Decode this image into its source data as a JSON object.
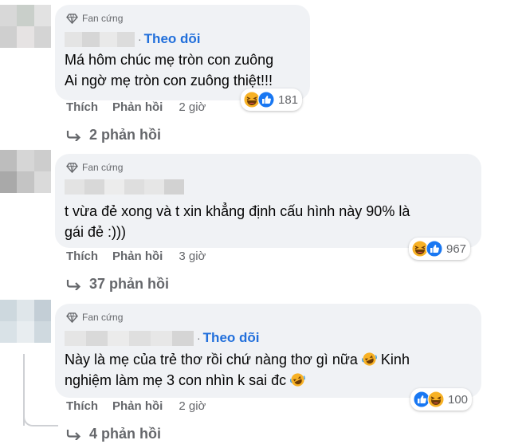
{
  "comments": [
    {
      "badge": "Fan cứng",
      "follow": "Theo dõi",
      "dot": "·",
      "text_lines": [
        "Má hôm chúc mẹ tròn con zuông",
        "Ai ngờ mẹ tròn con zuông thiệt!!!"
      ],
      "reactions": [
        "haha-icon",
        "like-icon"
      ],
      "reaction_count": "181",
      "like": "Thích",
      "reply": "Phản hồi",
      "time": "2 giờ",
      "replies": "2 phản hồi"
    },
    {
      "badge": "Fan cứng",
      "text_lines": [
        "t vừa đẻ xong và t xin khẳng định cấu hình này 90% là",
        "gái đẻ :)))"
      ],
      "reactions": [
        "haha-icon",
        "like-icon"
      ],
      "reaction_count": "967",
      "like": "Thích",
      "reply": "Phản hồi",
      "time": "3 giờ",
      "replies": "37 phản hồi"
    },
    {
      "badge": "Fan cứng",
      "follow": "Theo dõi",
      "dot": "·",
      "text_line1": "Này là mẹ của trẻ thơ rồi chứ nàng thơ gì nữa",
      "text_line1_end": "Kinh",
      "text_line2": "nghiệm làm mẹ 3 con nhìn k sai đc",
      "reactions": [
        "like-icon",
        "haha-icon"
      ],
      "reaction_count": "100",
      "like": "Thích",
      "reply": "Phản hồi",
      "time": "2 giờ",
      "replies": "4 phản hồi"
    }
  ],
  "colors": {
    "link": "#216fdb",
    "muted": "#65676b",
    "bubble": "#f0f2f5",
    "like_blue": "#1877f2",
    "haha_yellow": "#f7b125"
  }
}
